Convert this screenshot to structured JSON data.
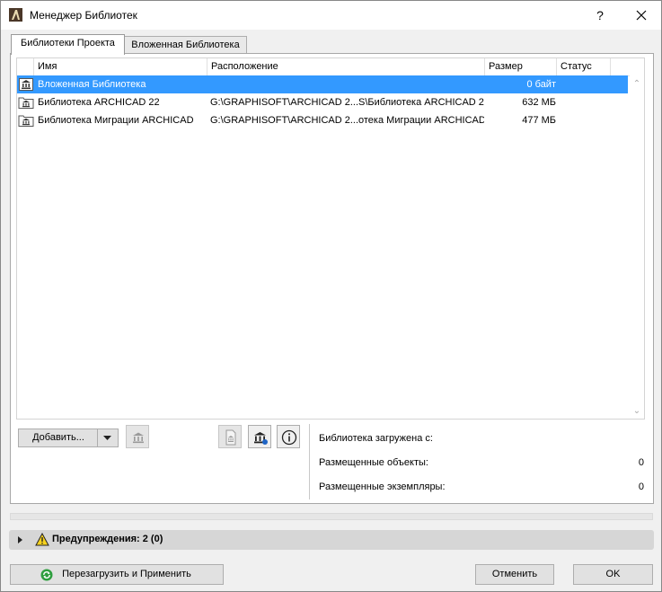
{
  "window": {
    "title": "Менеджер Библиотек",
    "help_label": "?"
  },
  "tabs": [
    {
      "label": "Библиотеки Проекта",
      "active": true
    },
    {
      "label": "Вложенная Библиотека",
      "active": false
    }
  ],
  "table": {
    "columns": [
      "Имя",
      "Расположение",
      "Размер",
      "Статус"
    ],
    "rows": [
      {
        "icon": "embedded-library-icon",
        "name": "Вложенная Библиотека",
        "location": "",
        "size": "0 байт",
        "status": "",
        "selected": true
      },
      {
        "icon": "library-folder-icon",
        "name": "Библиотека ARCHICAD 22",
        "location": "G:\\GRAPHISOFT\\ARCHICAD 2...S\\Библиотека ARCHICAD 22",
        "size": "632 МБ",
        "status": "",
        "selected": false
      },
      {
        "icon": "library-folder-icon",
        "name": "Библиотека Миграции ARCHICAD",
        "location": "G:\\GRAPHISOFT\\ARCHICAD 2...отека Миграции ARCHICAD",
        "size": "477 МБ",
        "status": "",
        "selected": false
      }
    ]
  },
  "actions": {
    "add_label": "Добавить..."
  },
  "info": {
    "loaded_from_label": "Библиотека загружена с:",
    "placed_objects_label": "Размещенные объекты:",
    "placed_objects_value": "0",
    "placed_instances_label": "Размещенные экземпляры:",
    "placed_instances_value": "0"
  },
  "warnings": {
    "label": "Предупреждения: 2 (0)"
  },
  "footer": {
    "reload_label": "Перезагрузить и Применить",
    "cancel_label": "Отменить",
    "ok_label": "OK"
  },
  "colors": {
    "selection": "#3399ff",
    "accent_green": "#2e9e3e",
    "warning_yellow": "#f7d21e"
  }
}
